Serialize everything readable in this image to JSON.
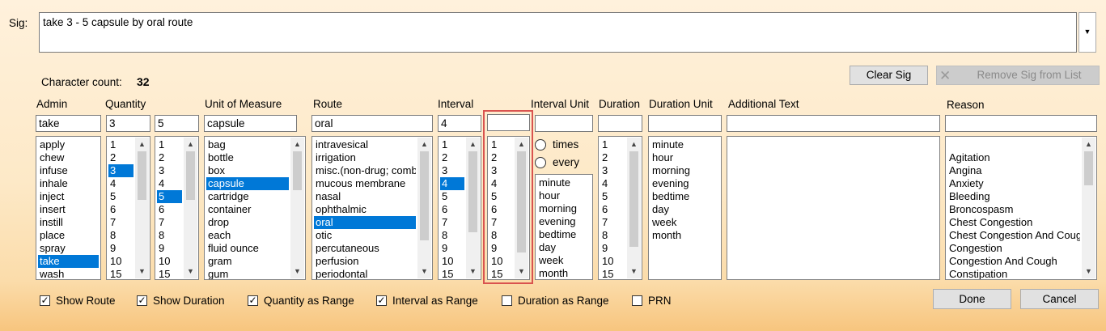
{
  "sig": {
    "label": "Sig:",
    "value": "take 3 - 5 capsule by oral route",
    "dropdown_icon": "chevron-down-icon"
  },
  "char_count": {
    "label": "Character count:",
    "value": "32"
  },
  "buttons": {
    "clear_sig": "Clear Sig",
    "remove_sig": "Remove Sig from List",
    "remove_icon": "close-icon",
    "done": "Done",
    "cancel": "Cancel"
  },
  "columns": {
    "admin": "Admin",
    "quantity": "Quantity",
    "unit": "Unit of Measure",
    "route": "Route",
    "interval": "Interval",
    "interval_unit": "Interval Unit",
    "duration": "Duration",
    "duration_unit": "Duration Unit",
    "additional_text": "Additional Text",
    "reason": "Reason"
  },
  "fields": {
    "admin": "take",
    "quantity_from": "3",
    "quantity_to": "5",
    "unit": "capsule",
    "route": "oral",
    "interval_from": "4",
    "interval_to": "",
    "interval_unit": "",
    "duration": "",
    "duration_unit": "",
    "additional_text": "",
    "reason": ""
  },
  "lists": {
    "admin": {
      "items": [
        "apply",
        "chew",
        "infuse",
        "inhale",
        "inject",
        "insert",
        "instill",
        "place",
        "spray",
        "take",
        "wash"
      ],
      "selected": 9
    },
    "quantity_from": {
      "items": [
        "1",
        "2",
        "3",
        "4",
        "5",
        "6",
        "7",
        "8",
        "9",
        "10",
        "15"
      ],
      "selected": 2
    },
    "quantity_to": {
      "items": [
        "1",
        "2",
        "3",
        "4",
        "5",
        "6",
        "7",
        "8",
        "9",
        "10",
        "15"
      ],
      "selected": 4
    },
    "unit": {
      "items": [
        "bag",
        "bottle",
        "box",
        "capsule",
        "cartridge",
        "container",
        "drop",
        "each",
        "fluid ounce",
        "gram",
        "gum"
      ],
      "selected": 3
    },
    "route": {
      "items": [
        "intravesical",
        "irrigation",
        "misc.(non-drug; combo route)",
        "mucous membrane",
        "nasal",
        "ophthalmic",
        "oral",
        "otic",
        "percutaneous",
        "perfusion",
        "periodontal"
      ],
      "selected": 6
    },
    "interval_from": {
      "items": [
        "1",
        "2",
        "3",
        "4",
        "5",
        "6",
        "7",
        "8",
        "9",
        "10",
        "15"
      ],
      "selected": 3
    },
    "interval_to": {
      "items": [
        "1",
        "2",
        "3",
        "4",
        "5",
        "6",
        "7",
        "8",
        "9",
        "10",
        "15"
      ],
      "selected": -1
    },
    "interval_unit": {
      "items": [
        "minute",
        "hour",
        "morning",
        "evening",
        "bedtime",
        "day",
        "week",
        "month"
      ],
      "selected": -1
    },
    "duration": {
      "items": [
        "1",
        "2",
        "3",
        "4",
        "5",
        "6",
        "7",
        "8",
        "9",
        "10",
        "15"
      ],
      "selected": -1
    },
    "duration_unit": {
      "items": [
        "minute",
        "hour",
        "morning",
        "evening",
        "bedtime",
        "day",
        "week",
        "month"
      ],
      "selected": -1
    },
    "reason": {
      "items": [
        "",
        "Agitation",
        "Angina",
        "Anxiety",
        "Bleeding",
        "Broncospasm",
        "Chest Congestion",
        "Chest Congestion And Cough",
        "Congestion",
        "Congestion And Cough",
        "Constipation"
      ],
      "selected": -1
    }
  },
  "interval_mode": {
    "times": "times",
    "every": "every"
  },
  "checkboxes": [
    {
      "label": "Show Route",
      "checked": true
    },
    {
      "label": "Show Duration",
      "checked": true
    },
    {
      "label": "Quantity as Range",
      "checked": true
    },
    {
      "label": "Interval as Range",
      "checked": true
    },
    {
      "label": "Duration as Range",
      "checked": false
    },
    {
      "label": "PRN",
      "checked": false
    }
  ],
  "colors": {
    "selection": "#0078d7",
    "highlight_border": "#d9534f"
  }
}
